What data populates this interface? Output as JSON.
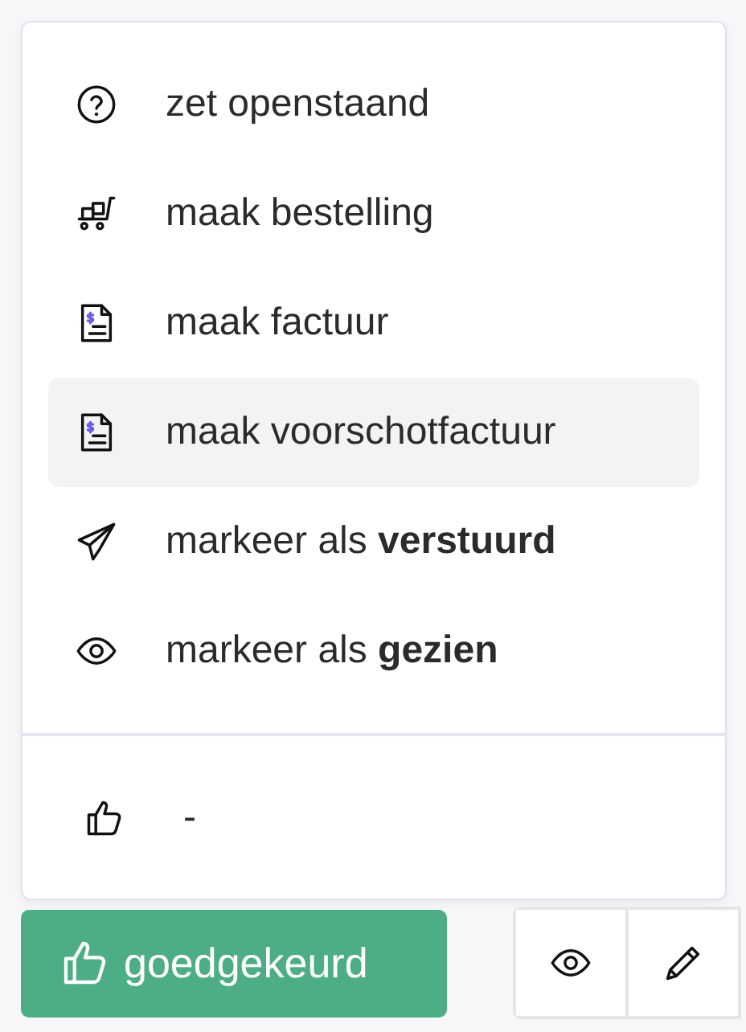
{
  "menu": {
    "items": [
      {
        "kind": "question",
        "label": "zet openstaand",
        "highlighted": false
      },
      {
        "kind": "cart",
        "label": "maak bestelling",
        "highlighted": false
      },
      {
        "kind": "invoice",
        "label": "maak factuur",
        "highlighted": false
      },
      {
        "kind": "invoice",
        "label": "maak voorschotfactuur",
        "highlighted": true
      },
      {
        "kind": "send",
        "label": "markeer als **verstuurd**",
        "highlighted": false
      },
      {
        "kind": "eye",
        "label": "markeer als **gezien**",
        "highlighted": false
      }
    ],
    "footer": {
      "kind": "thumb",
      "label": "-"
    }
  },
  "status_button": {
    "kind": "thumb",
    "label": "goedgekeurd"
  },
  "actions": [
    {
      "kind": "eye"
    },
    {
      "kind": "pencil"
    }
  ]
}
